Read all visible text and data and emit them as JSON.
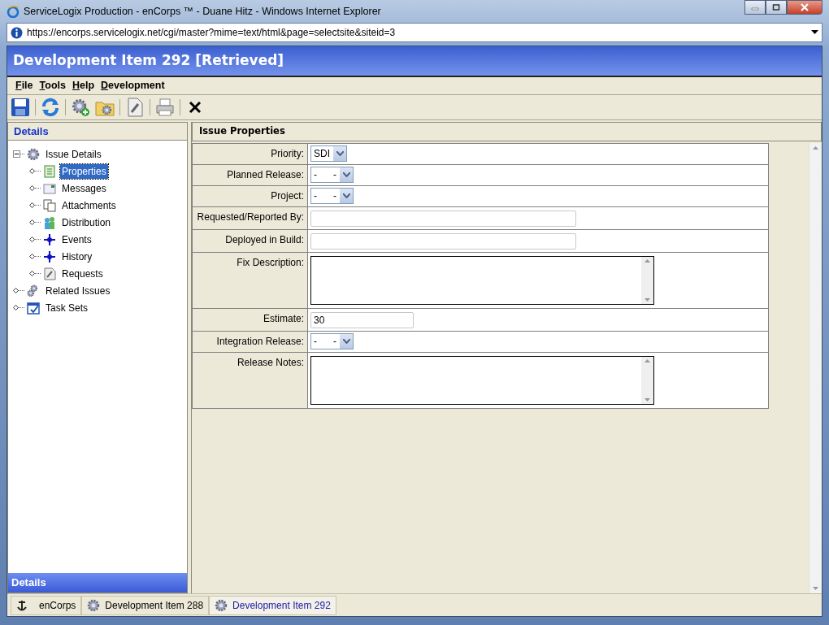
{
  "window": {
    "title": "ServiceLogix Production - enCorps ™ - Duane Hitz - Windows Internet Explorer"
  },
  "address_bar": {
    "url": "https://encorps.servicelogix.net/cgi/master?mime=text/html&page=selectsite&siteid=3"
  },
  "app_header": {
    "title": "Development Item 292 [Retrieved]"
  },
  "menu": [
    "File",
    "Tools",
    "Help",
    "Development"
  ],
  "sidebar": {
    "header": "Details",
    "footer": "Details",
    "items": [
      {
        "label": "Issue Details",
        "selected": false,
        "expanded": true,
        "children": [
          {
            "label": "Properties",
            "selected": true
          },
          {
            "label": "Messages",
            "selected": false
          },
          {
            "label": "Attachments",
            "selected": false
          },
          {
            "label": "Distribution",
            "selected": false
          },
          {
            "label": "Events",
            "selected": false
          },
          {
            "label": "History",
            "selected": false
          },
          {
            "label": "Requests",
            "selected": false
          }
        ]
      },
      {
        "label": "Related Issues",
        "selected": false
      },
      {
        "label": "Task Sets",
        "selected": false
      }
    ]
  },
  "panel": {
    "title": "Issue Properties",
    "fields": [
      {
        "label": "Priority:",
        "kind": "select",
        "value": "SDI"
      },
      {
        "label": "Planned Release:",
        "kind": "select",
        "value": "-      -"
      },
      {
        "label": "Project:",
        "kind": "select",
        "value": "-      -"
      },
      {
        "label": "Requested/Reported By:",
        "kind": "text"
      },
      {
        "label": "Deployed in Build:",
        "kind": "text"
      },
      {
        "label": "Fix Description:",
        "kind": "textarea"
      },
      {
        "label": "Estimate:",
        "kind": "short",
        "value": "30"
      },
      {
        "label": "Integration Release:",
        "kind": "select",
        "value": "-      -"
      },
      {
        "label": "Release Notes:",
        "kind": "textarea"
      }
    ]
  },
  "task_tabs": [
    {
      "label": "enCorps",
      "selected": false
    },
    {
      "label": "Development Item 288",
      "selected": false
    },
    {
      "label": "Development Item 292",
      "selected": true
    }
  ]
}
